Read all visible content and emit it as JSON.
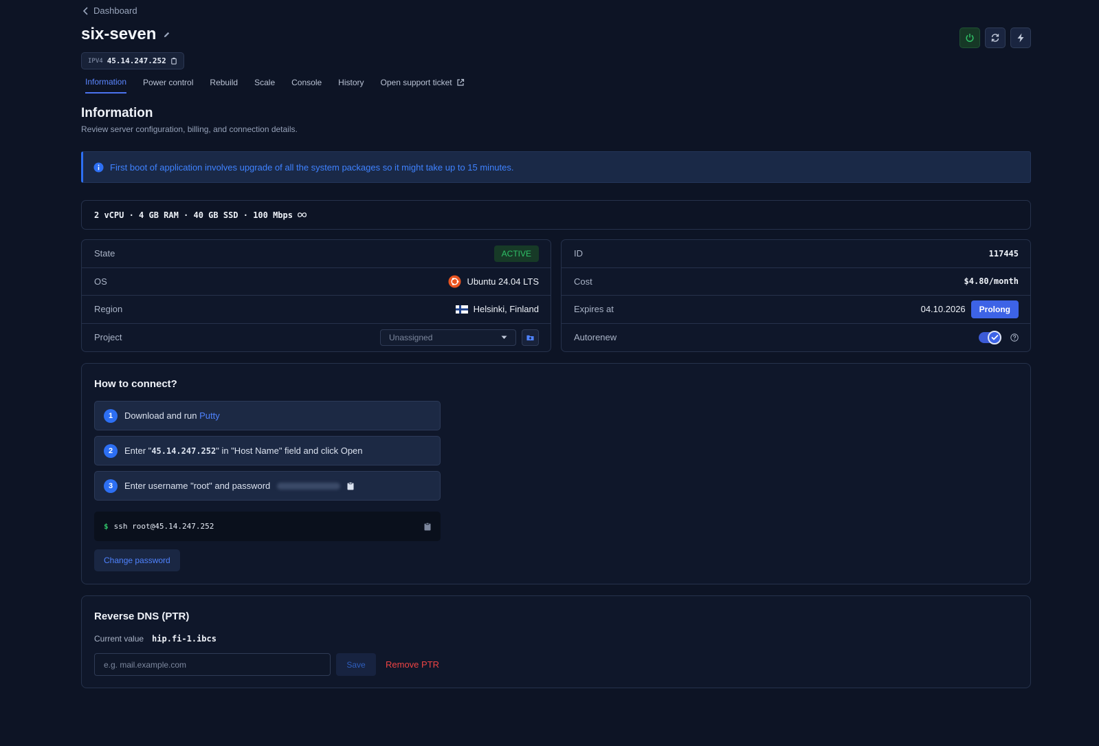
{
  "nav": {
    "back_label": "Dashboard"
  },
  "server": {
    "name": "six-seven",
    "ip_label": "IPV4",
    "ip": "45.14.247.252"
  },
  "tabs": [
    {
      "label": "Information",
      "active": true
    },
    {
      "label": "Power control"
    },
    {
      "label": "Rebuild"
    },
    {
      "label": "Scale"
    },
    {
      "label": "Console"
    },
    {
      "label": "History"
    },
    {
      "label": "Open support ticket"
    }
  ],
  "section": {
    "title": "Information",
    "subtitle": "Review server configuration, billing, and connection details."
  },
  "alert": {
    "text": "First boot of application involves upgrade of all the system packages so it might take up to 15 minutes."
  },
  "specs": {
    "text": "2 vCPU · 4 GB RAM · 40 GB SSD · 100 Mbps"
  },
  "details_left": {
    "state_label": "State",
    "state_value": "ACTIVE",
    "os_label": "OS",
    "os_value": "Ubuntu 24.04 LTS",
    "region_label": "Region",
    "region_value": "Helsinki, Finland",
    "project_label": "Project",
    "project_value": "Unassigned"
  },
  "details_right": {
    "id_label": "ID",
    "id_value": "117445",
    "cost_label": "Cost",
    "cost_value": "$4.80/month",
    "expires_label": "Expires at",
    "expires_value": "04.10.2026",
    "prolong_label": "Prolong",
    "autorenew_label": "Autorenew",
    "autorenew_enabled": true
  },
  "connect": {
    "title": "How to connect?",
    "step1_num": "1",
    "step1_text": "Download and run ",
    "step1_link": "Putty",
    "step2_num": "2",
    "step2_pre": "Enter \"",
    "step2_ip": "45.14.247.252",
    "step2_post": "\" in \"Host Name\" field and click Open",
    "step3_num": "3",
    "step3_text": "Enter username \"root\" and password",
    "ssh_prompt": "$",
    "ssh_command": "ssh root@45.14.247.252",
    "change_password_label": "Change password"
  },
  "dns": {
    "title": "Reverse DNS (PTR)",
    "current_label": "Current value",
    "current_value": "hip.fi-1.ibcs",
    "input_placeholder": "e.g. mail.example.com",
    "save_label": "Save",
    "remove_label": "Remove PTR"
  },
  "colors": {
    "accent": "#3d63e6",
    "link": "#4f83ff",
    "success": "#2fc067",
    "danger": "#ef4444",
    "background": "#0d1425"
  }
}
